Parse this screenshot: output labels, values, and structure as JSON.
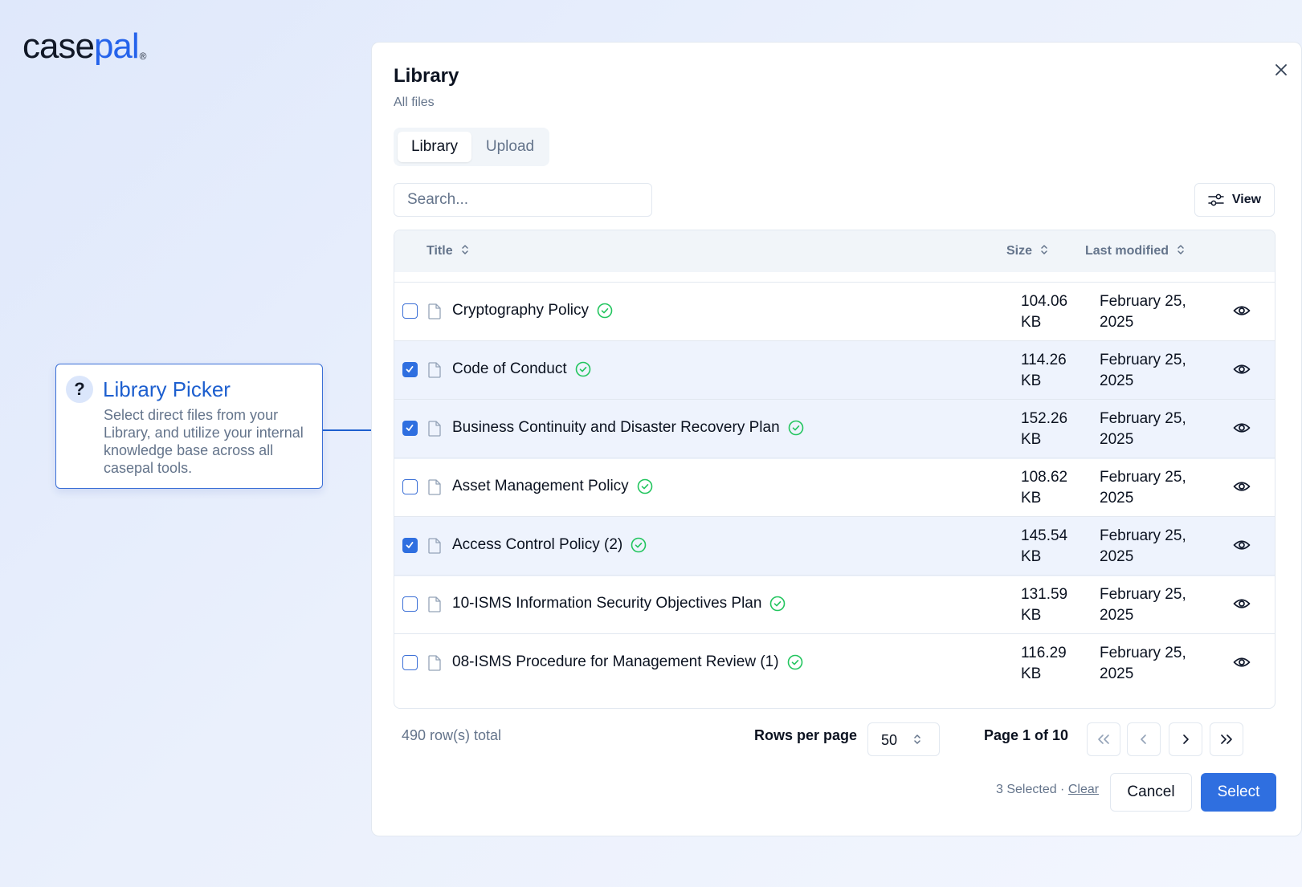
{
  "brand": {
    "logo_part1": "case",
    "logo_part2": "pal",
    "logo_mark": "®"
  },
  "callout": {
    "icon": "question-mark-icon",
    "icon_text": "?",
    "title": "Library Picker",
    "description": "Select direct files from your Library, and utilize your internal knowledge base across all casepal tools."
  },
  "dialog": {
    "title": "Library",
    "subtitle": "All files",
    "tabs": [
      {
        "label": "Library",
        "active": true
      },
      {
        "label": "Upload",
        "active": false
      }
    ],
    "search": {
      "placeholder": "Search...",
      "value": ""
    },
    "view_button": {
      "label": "View",
      "icon": "sliders-icon"
    },
    "table": {
      "columns": {
        "title": "Title",
        "size": "Size",
        "last_modified": "Last modified"
      },
      "rows": [
        {
          "title": "Cryptography Policy",
          "size_value": "104.06",
          "size_unit": "KB",
          "date_line1": "February 25,",
          "date_line2": "2025",
          "selected": false
        },
        {
          "title": "Code of Conduct",
          "size_value": "114.26",
          "size_unit": "KB",
          "date_line1": "February 25,",
          "date_line2": "2025",
          "selected": true
        },
        {
          "title": "Business Continuity and Disaster Recovery Plan",
          "size_value": "152.26",
          "size_unit": "KB",
          "date_line1": "February 25,",
          "date_line2": "2025",
          "selected": true
        },
        {
          "title": "Asset Management Policy",
          "size_value": "108.62",
          "size_unit": "KB",
          "date_line1": "February 25,",
          "date_line2": "2025",
          "selected": false
        },
        {
          "title": "Access Control Policy (2)",
          "size_value": "145.54",
          "size_unit": "KB",
          "date_line1": "February 25,",
          "date_line2": "2025",
          "selected": true
        },
        {
          "title": "10-ISMS Information Security Objectives Plan",
          "size_value": "131.59",
          "size_unit": "KB",
          "date_line1": "February 25,",
          "date_line2": "2025",
          "selected": false
        },
        {
          "title": "08-ISMS Procedure for Management Review (1)",
          "size_value": "116.29",
          "size_unit": "KB",
          "date_line1": "February 25,",
          "date_line2": "2025",
          "selected": false
        }
      ]
    },
    "pagination": {
      "total_text": "490 row(s) total",
      "rows_per_page_label": "Rows per page",
      "rows_per_page_value": "50",
      "page_info": "Page 1 of 10"
    },
    "footer": {
      "selected_text": "3 Selected · ",
      "clear_label": "Clear",
      "cancel_label": "Cancel",
      "select_label": "Select"
    }
  },
  "colors": {
    "accent": "#2f6fe0",
    "brand_blue": "#2563eb",
    "status_ok": "#22c55e",
    "row_selected_bg": "#eef3fd"
  }
}
